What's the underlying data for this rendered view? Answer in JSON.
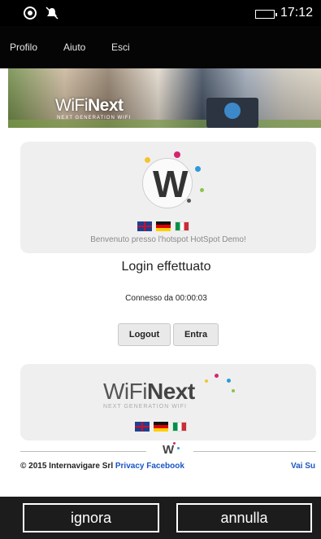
{
  "status": {
    "time": "17:12"
  },
  "nav": {
    "profile": "Profilo",
    "help": "Aiuto",
    "logout": "Esci"
  },
  "banner": {
    "brand_thin": "WiFi",
    "brand_bold": "Next",
    "tagline": "NEXT GENERATION WIFI"
  },
  "portal": {
    "welcome": "Benvenuto presso l'hotspot HotSpot Demo!",
    "title": "Login effettuato",
    "connected": "Connesso da 00:00:03",
    "logout_button": "Logout",
    "enter_button": "Entra"
  },
  "logo_card": {
    "brand_thin": "WiFi",
    "brand_bold": "Next",
    "tagline": "NEXT GENERATION WIFI"
  },
  "footer": {
    "copyright": "© 2015 Internavigare Srl",
    "privacy": "Privacy",
    "facebook": "Facebook",
    "top": "Vai Su"
  },
  "appbar": {
    "ignore": "ignora",
    "cancel": "annulla"
  },
  "icons": [
    "network-icon",
    "notification-off-icon",
    "battery-icon",
    "flag-uk-icon",
    "flag-de-icon",
    "flag-it-icon",
    "wifinext-w-logo-icon"
  ]
}
